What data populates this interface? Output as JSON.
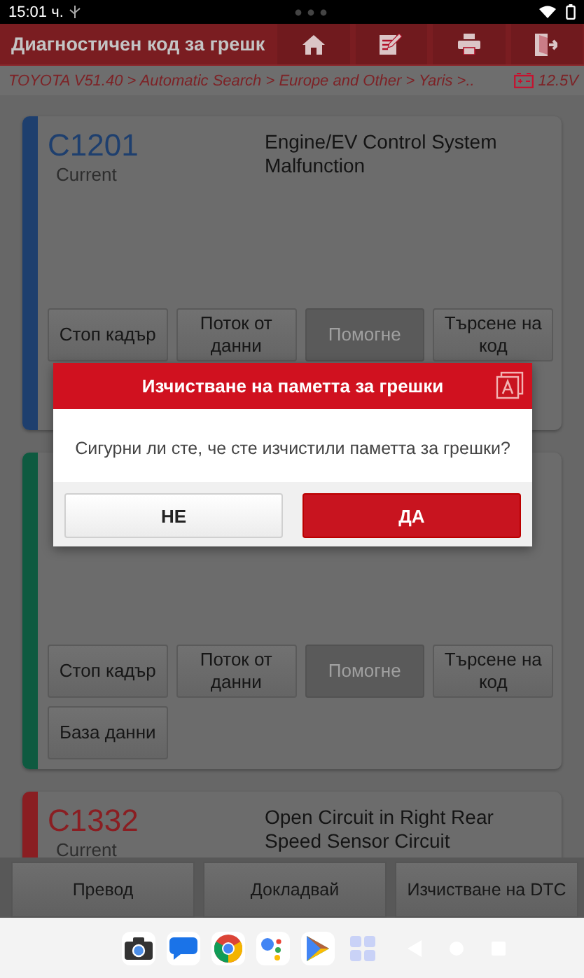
{
  "status_bar": {
    "time": "15:01 ч."
  },
  "header": {
    "title": "Диагностичен код за грешк",
    "buttons": [
      {
        "kind": "home"
      },
      {
        "kind": "edit"
      },
      {
        "kind": "print"
      },
      {
        "kind": "exit"
      }
    ]
  },
  "breadcrumb": {
    "path": "TOYOTA V51.40 > Automatic Search > Europe and Other > Yaris >..",
    "voltage": "12.5V"
  },
  "cards": [
    {
      "color": "#1e3f6e",
      "code": "C1201",
      "status": "Current",
      "description": "Engine/EV Control System Malfunction",
      "buttons": [
        {
          "label": "Стоп кадър",
          "disabled": false
        },
        {
          "label": "Поток от данни",
          "disabled": false
        },
        {
          "label": "Помогне",
          "disabled": true
        },
        {
          "label": "Търсене на код",
          "disabled": false
        }
      ]
    },
    {
      "color": "#0e5a40",
      "buttons": [
        {
          "label": "Стоп кадър",
          "disabled": false
        },
        {
          "label": "Поток от данни",
          "disabled": false
        },
        {
          "label": "Помогне",
          "disabled": true
        },
        {
          "label": "Търсене на код",
          "disabled": false
        },
        {
          "label": "База данни",
          "disabled": false
        }
      ]
    },
    {
      "color": "#8a1e22",
      "code": "C1332",
      "status": "Current",
      "description": "Open Circuit in Right Rear Speed Sensor Circuit"
    }
  ],
  "bottom_buttons": [
    "Превод",
    "Докладвай",
    "Изчистване на DTC"
  ],
  "dialog": {
    "title": "Изчистване на паметта за грешки",
    "message": "Сигурни ли сте, че сте изчистили паметта за грешки?",
    "buttons": [
      {
        "label": "НЕ",
        "kind": "secondary"
      },
      {
        "label": "ДА",
        "kind": "primary"
      }
    ]
  },
  "nav_bar": {
    "apps": [
      {
        "kind": "camera"
      },
      {
        "kind": "messages"
      },
      {
        "kind": "chrome"
      },
      {
        "kind": "assistant"
      },
      {
        "kind": "play"
      },
      {
        "kind": "grid"
      }
    ]
  }
}
